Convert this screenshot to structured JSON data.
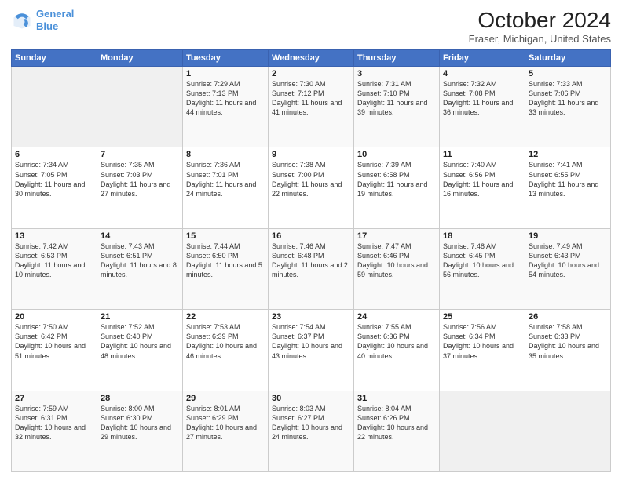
{
  "header": {
    "logo_line1": "General",
    "logo_line2": "Blue",
    "title": "October 2024",
    "subtitle": "Fraser, Michigan, United States"
  },
  "days_of_week": [
    "Sunday",
    "Monday",
    "Tuesday",
    "Wednesday",
    "Thursday",
    "Friday",
    "Saturday"
  ],
  "weeks": [
    [
      {
        "day": "",
        "sunrise": "",
        "sunset": "",
        "daylight": "",
        "empty": true
      },
      {
        "day": "",
        "sunrise": "",
        "sunset": "",
        "daylight": "",
        "empty": true
      },
      {
        "day": "1",
        "sunrise": "Sunrise: 7:29 AM",
        "sunset": "Sunset: 7:13 PM",
        "daylight": "Daylight: 11 hours and 44 minutes."
      },
      {
        "day": "2",
        "sunrise": "Sunrise: 7:30 AM",
        "sunset": "Sunset: 7:12 PM",
        "daylight": "Daylight: 11 hours and 41 minutes."
      },
      {
        "day": "3",
        "sunrise": "Sunrise: 7:31 AM",
        "sunset": "Sunset: 7:10 PM",
        "daylight": "Daylight: 11 hours and 39 minutes."
      },
      {
        "day": "4",
        "sunrise": "Sunrise: 7:32 AM",
        "sunset": "Sunset: 7:08 PM",
        "daylight": "Daylight: 11 hours and 36 minutes."
      },
      {
        "day": "5",
        "sunrise": "Sunrise: 7:33 AM",
        "sunset": "Sunset: 7:06 PM",
        "daylight": "Daylight: 11 hours and 33 minutes."
      }
    ],
    [
      {
        "day": "6",
        "sunrise": "Sunrise: 7:34 AM",
        "sunset": "Sunset: 7:05 PM",
        "daylight": "Daylight: 11 hours and 30 minutes."
      },
      {
        "day": "7",
        "sunrise": "Sunrise: 7:35 AM",
        "sunset": "Sunset: 7:03 PM",
        "daylight": "Daylight: 11 hours and 27 minutes."
      },
      {
        "day": "8",
        "sunrise": "Sunrise: 7:36 AM",
        "sunset": "Sunset: 7:01 PM",
        "daylight": "Daylight: 11 hours and 24 minutes."
      },
      {
        "day": "9",
        "sunrise": "Sunrise: 7:38 AM",
        "sunset": "Sunset: 7:00 PM",
        "daylight": "Daylight: 11 hours and 22 minutes."
      },
      {
        "day": "10",
        "sunrise": "Sunrise: 7:39 AM",
        "sunset": "Sunset: 6:58 PM",
        "daylight": "Daylight: 11 hours and 19 minutes."
      },
      {
        "day": "11",
        "sunrise": "Sunrise: 7:40 AM",
        "sunset": "Sunset: 6:56 PM",
        "daylight": "Daylight: 11 hours and 16 minutes."
      },
      {
        "day": "12",
        "sunrise": "Sunrise: 7:41 AM",
        "sunset": "Sunset: 6:55 PM",
        "daylight": "Daylight: 11 hours and 13 minutes."
      }
    ],
    [
      {
        "day": "13",
        "sunrise": "Sunrise: 7:42 AM",
        "sunset": "Sunset: 6:53 PM",
        "daylight": "Daylight: 11 hours and 10 minutes."
      },
      {
        "day": "14",
        "sunrise": "Sunrise: 7:43 AM",
        "sunset": "Sunset: 6:51 PM",
        "daylight": "Daylight: 11 hours and 8 minutes."
      },
      {
        "day": "15",
        "sunrise": "Sunrise: 7:44 AM",
        "sunset": "Sunset: 6:50 PM",
        "daylight": "Daylight: 11 hours and 5 minutes."
      },
      {
        "day": "16",
        "sunrise": "Sunrise: 7:46 AM",
        "sunset": "Sunset: 6:48 PM",
        "daylight": "Daylight: 11 hours and 2 minutes."
      },
      {
        "day": "17",
        "sunrise": "Sunrise: 7:47 AM",
        "sunset": "Sunset: 6:46 PM",
        "daylight": "Daylight: 10 hours and 59 minutes."
      },
      {
        "day": "18",
        "sunrise": "Sunrise: 7:48 AM",
        "sunset": "Sunset: 6:45 PM",
        "daylight": "Daylight: 10 hours and 56 minutes."
      },
      {
        "day": "19",
        "sunrise": "Sunrise: 7:49 AM",
        "sunset": "Sunset: 6:43 PM",
        "daylight": "Daylight: 10 hours and 54 minutes."
      }
    ],
    [
      {
        "day": "20",
        "sunrise": "Sunrise: 7:50 AM",
        "sunset": "Sunset: 6:42 PM",
        "daylight": "Daylight: 10 hours and 51 minutes."
      },
      {
        "day": "21",
        "sunrise": "Sunrise: 7:52 AM",
        "sunset": "Sunset: 6:40 PM",
        "daylight": "Daylight: 10 hours and 48 minutes."
      },
      {
        "day": "22",
        "sunrise": "Sunrise: 7:53 AM",
        "sunset": "Sunset: 6:39 PM",
        "daylight": "Daylight: 10 hours and 46 minutes."
      },
      {
        "day": "23",
        "sunrise": "Sunrise: 7:54 AM",
        "sunset": "Sunset: 6:37 PM",
        "daylight": "Daylight: 10 hours and 43 minutes."
      },
      {
        "day": "24",
        "sunrise": "Sunrise: 7:55 AM",
        "sunset": "Sunset: 6:36 PM",
        "daylight": "Daylight: 10 hours and 40 minutes."
      },
      {
        "day": "25",
        "sunrise": "Sunrise: 7:56 AM",
        "sunset": "Sunset: 6:34 PM",
        "daylight": "Daylight: 10 hours and 37 minutes."
      },
      {
        "day": "26",
        "sunrise": "Sunrise: 7:58 AM",
        "sunset": "Sunset: 6:33 PM",
        "daylight": "Daylight: 10 hours and 35 minutes."
      }
    ],
    [
      {
        "day": "27",
        "sunrise": "Sunrise: 7:59 AM",
        "sunset": "Sunset: 6:31 PM",
        "daylight": "Daylight: 10 hours and 32 minutes."
      },
      {
        "day": "28",
        "sunrise": "Sunrise: 8:00 AM",
        "sunset": "Sunset: 6:30 PM",
        "daylight": "Daylight: 10 hours and 29 minutes."
      },
      {
        "day": "29",
        "sunrise": "Sunrise: 8:01 AM",
        "sunset": "Sunset: 6:29 PM",
        "daylight": "Daylight: 10 hours and 27 minutes."
      },
      {
        "day": "30",
        "sunrise": "Sunrise: 8:03 AM",
        "sunset": "Sunset: 6:27 PM",
        "daylight": "Daylight: 10 hours and 24 minutes."
      },
      {
        "day": "31",
        "sunrise": "Sunrise: 8:04 AM",
        "sunset": "Sunset: 6:26 PM",
        "daylight": "Daylight: 10 hours and 22 minutes."
      },
      {
        "day": "",
        "sunrise": "",
        "sunset": "",
        "daylight": "",
        "empty": true
      },
      {
        "day": "",
        "sunrise": "",
        "sunset": "",
        "daylight": "",
        "empty": true
      }
    ]
  ]
}
